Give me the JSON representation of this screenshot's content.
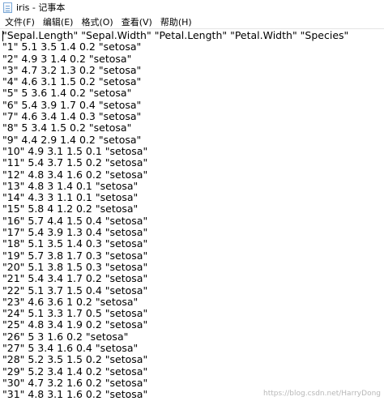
{
  "window": {
    "title": "iris - 记事本"
  },
  "menu": [
    {
      "label": "文件(F)"
    },
    {
      "label": "编辑(E)"
    },
    {
      "label": "格式(O)"
    },
    {
      "label": "查看(V)"
    },
    {
      "label": "帮助(H)"
    }
  ],
  "document": {
    "lines": [
      "\"Sepal.Length\" \"Sepal.Width\" \"Petal.Length\" \"Petal.Width\" \"Species\"",
      "\"1\" 5.1 3.5 1.4 0.2 \"setosa\"",
      "\"2\" 4.9 3 1.4 0.2 \"setosa\"",
      "\"3\" 4.7 3.2 1.3 0.2 \"setosa\"",
      "\"4\" 4.6 3.1 1.5 0.2 \"setosa\"",
      "\"5\" 5 3.6 1.4 0.2 \"setosa\"",
      "\"6\" 5.4 3.9 1.7 0.4 \"setosa\"",
      "\"7\" 4.6 3.4 1.4 0.3 \"setosa\"",
      "\"8\" 5 3.4 1.5 0.2 \"setosa\"",
      "\"9\" 4.4 2.9 1.4 0.2 \"setosa\"",
      "\"10\" 4.9 3.1 1.5 0.1 \"setosa\"",
      "\"11\" 5.4 3.7 1.5 0.2 \"setosa\"",
      "\"12\" 4.8 3.4 1.6 0.2 \"setosa\"",
      "\"13\" 4.8 3 1.4 0.1 \"setosa\"",
      "\"14\" 4.3 3 1.1 0.1 \"setosa\"",
      "\"15\" 5.8 4 1.2 0.2 \"setosa\"",
      "\"16\" 5.7 4.4 1.5 0.4 \"setosa\"",
      "\"17\" 5.4 3.9 1.3 0.4 \"setosa\"",
      "\"18\" 5.1 3.5 1.4 0.3 \"setosa\"",
      "\"19\" 5.7 3.8 1.7 0.3 \"setosa\"",
      "\"20\" 5.1 3.8 1.5 0.3 \"setosa\"",
      "\"21\" 5.4 3.4 1.7 0.2 \"setosa\"",
      "\"22\" 5.1 3.7 1.5 0.4 \"setosa\"",
      "\"23\" 4.6 3.6 1 0.2 \"setosa\"",
      "\"24\" 5.1 3.3 1.7 0.5 \"setosa\"",
      "\"25\" 4.8 3.4 1.9 0.2 \"setosa\"",
      "\"26\" 5 3 1.6 0.2 \"setosa\"",
      "\"27\" 5 3.4 1.6 0.4 \"setosa\"",
      "\"28\" 5.2 3.5 1.5 0.2 \"setosa\"",
      "\"29\" 5.2 3.4 1.4 0.2 \"setosa\"",
      "\"30\" 4.7 3.2 1.6 0.2 \"setosa\"",
      "\"31\" 4.8 3.1 1.6 0.2 \"setosa\""
    ]
  },
  "watermark": "https://blog.csdn.net/HarryDong"
}
